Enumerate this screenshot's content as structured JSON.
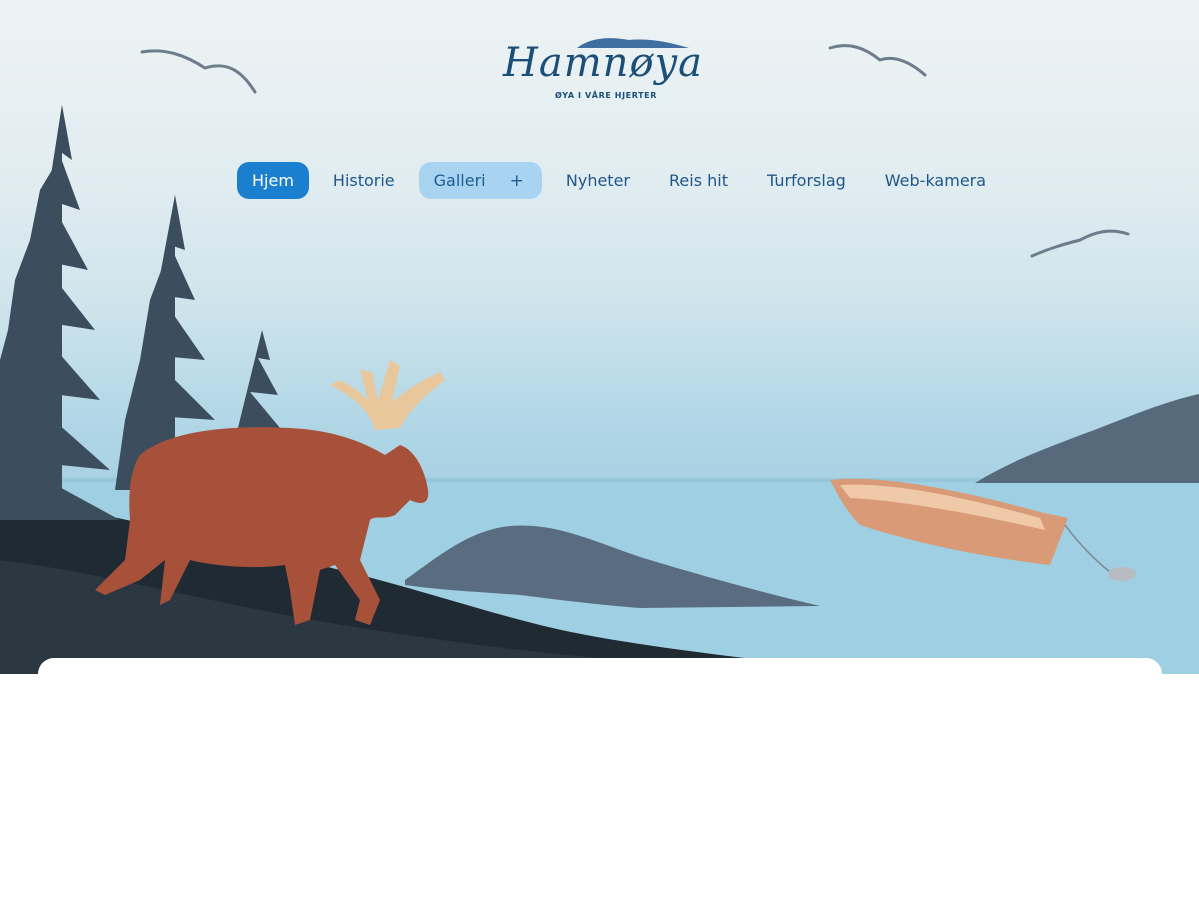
{
  "logo": {
    "title": "Hamnøya",
    "tagline": "ØYA I VÅRE HJERTER"
  },
  "nav": {
    "items": [
      {
        "label": "Hjem",
        "active": true
      },
      {
        "label": "Historie"
      },
      {
        "label": "Galleri",
        "expand_label": "+"
      },
      {
        "label": "Nyheter"
      },
      {
        "label": "Reis hit"
      },
      {
        "label": "Turforslag"
      },
      {
        "label": "Web-kamera"
      }
    ]
  },
  "colors": {
    "accent": "#1b7fcf",
    "accent_light": "#a8d4f2",
    "nav_text": "#20578a",
    "water": "#9fd0e3",
    "tree": "#3a4c5c",
    "moose": "#a8513a"
  },
  "icons": {
    "galleri_expand": "plus-icon"
  }
}
